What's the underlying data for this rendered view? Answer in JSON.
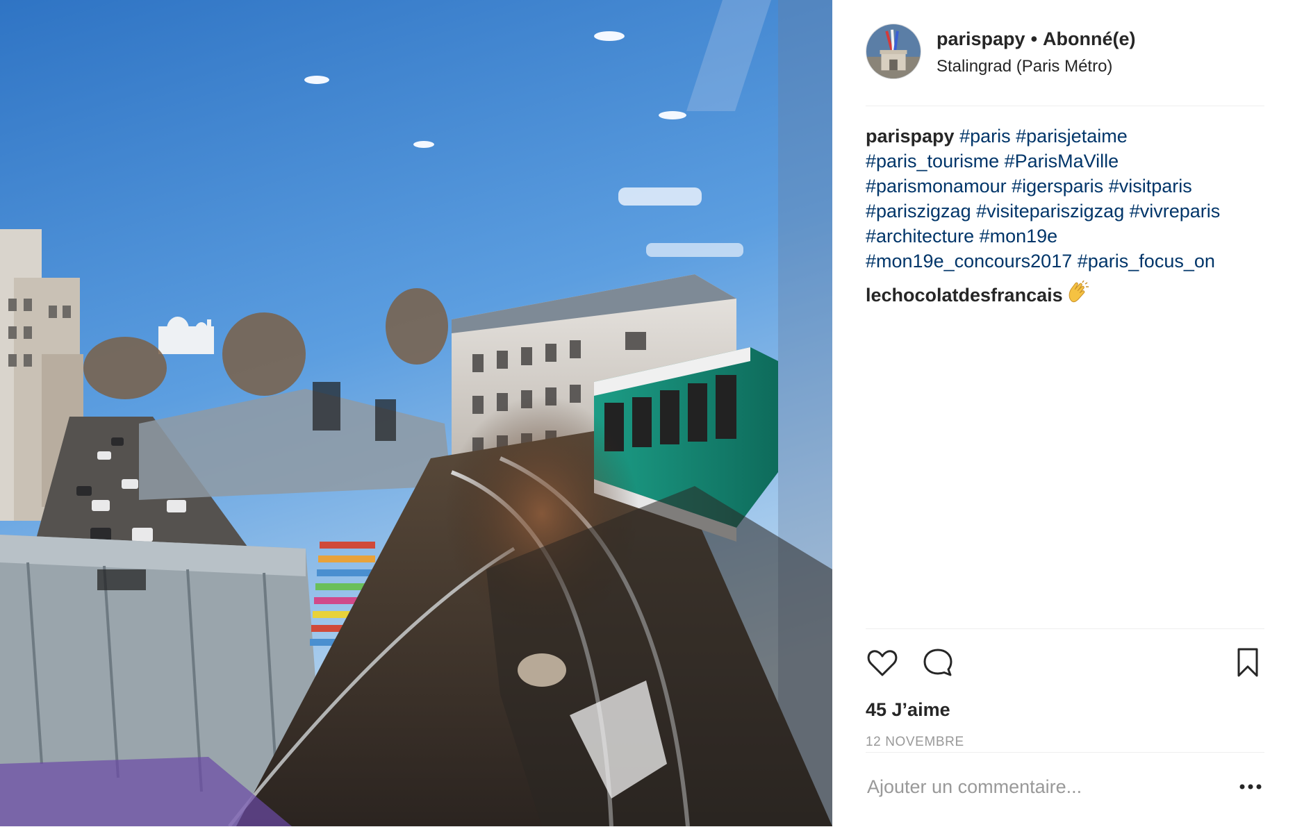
{
  "photo": {
    "icon": "photo-reflection-metro-train",
    "colors": {
      "sky": "#4f8fd6",
      "train_green": "#1f9e86"
    }
  },
  "header": {
    "username": "parispapy",
    "separator": "•",
    "follow_state": "Abonné(e)",
    "location": "Stalingrad (Paris Métro)",
    "avatar_icon": "avatar-arc-de-triomphe"
  },
  "caption": {
    "username": "parispapy",
    "hashtags": [
      "#paris",
      "#parisjetaime",
      "#paris_tourisme",
      "#ParisMaVille",
      "#parismonamour",
      "#igersparis",
      "#visitparis",
      "#pariszigzag",
      "#visiteparis zigzag",
      "#vivreparis",
      "#architecture",
      "#mon19e",
      "#mon19e_concours2017",
      "#paris_focus_on"
    ]
  },
  "comments": [
    {
      "username": "lechocolatdesfrancais",
      "text": "",
      "emoji_icon": "clapping-hands-icon"
    }
  ],
  "actions": {
    "like_icon": "heart-icon",
    "comment_icon": "speech-bubble-icon",
    "save_icon": "bookmark-icon",
    "likes_text": "45 J’aime",
    "date_text": "12 NOVEMBRE"
  },
  "add_comment": {
    "placeholder": "Ajouter un commentaire...",
    "more_icon": "ellipsis-icon"
  },
  "colors": {
    "hashtag": "#003569",
    "text": "#262626",
    "muted": "#999999",
    "divider": "#efefef"
  }
}
